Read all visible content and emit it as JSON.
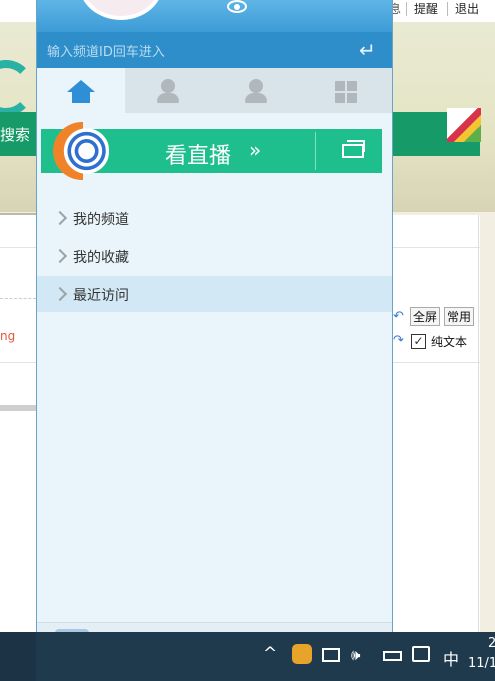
{
  "background_page": {
    "top_links": [
      "提醒",
      "退出"
    ],
    "top_fragment": "息",
    "search_button": "搜索",
    "partial_text": "ng",
    "buttons": {
      "fullscreen": "全屏",
      "common": "常用"
    },
    "plain_text_label": "纯文本"
  },
  "panel": {
    "channel_input_placeholder": "输入频道ID回车进入",
    "tabs": [
      {
        "name": "home",
        "icon": "home-icon",
        "active": true
      },
      {
        "name": "person",
        "icon": "person-icon",
        "active": false
      },
      {
        "name": "contacts",
        "icon": "contacts-icon",
        "active": false
      },
      {
        "name": "apps",
        "icon": "grid-icon",
        "active": false
      }
    ],
    "live_button": {
      "label": "看直播",
      "arrows": "»"
    },
    "menu": [
      {
        "label": "我的频道",
        "highlight": false
      },
      {
        "label": "我的收藏",
        "highlight": false
      },
      {
        "label": "最近访问",
        "highlight": true
      }
    ]
  },
  "taskbar": {
    "chevron": "^",
    "volume": "🕪",
    "ime": "中",
    "clock_line1": "2",
    "clock_line2": "11/1"
  },
  "colors": {
    "panel_bg": "#e9f4fb",
    "header_blue": "#3d9bd6",
    "input_bar": "#2e8ec9",
    "live_green": "#1fbf8d",
    "taskbar": "#1f3a4d"
  }
}
